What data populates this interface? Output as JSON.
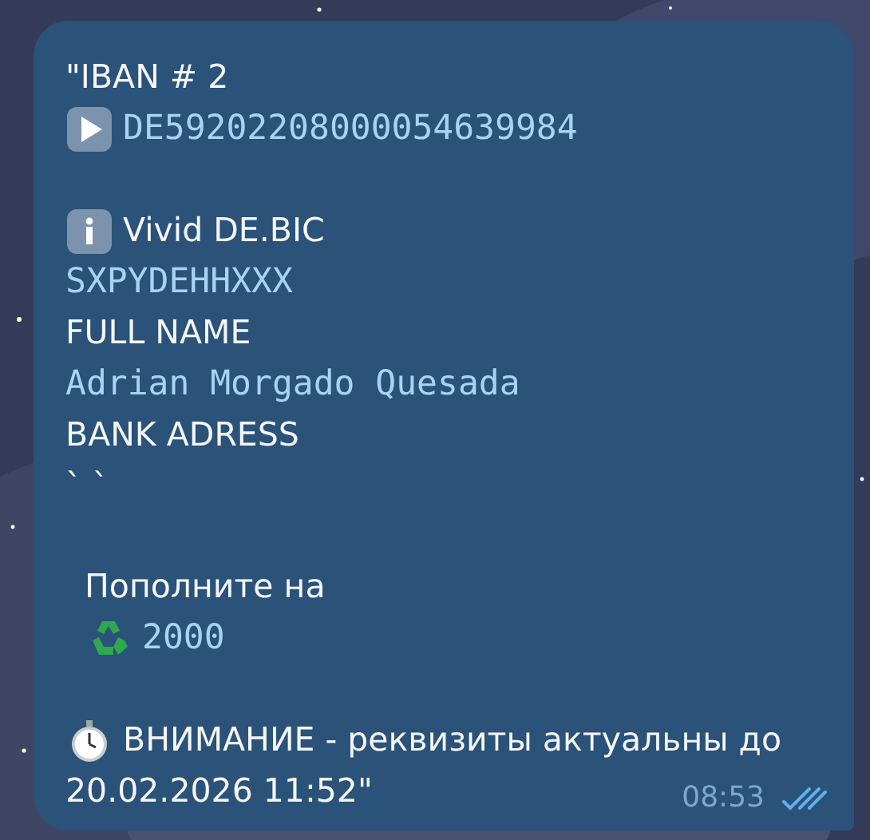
{
  "message": {
    "lines": [
      {
        "kind": "text",
        "text": "\"IBAN # 2"
      },
      {
        "kind": "code",
        "text": "DE59202208000054639984"
      },
      {
        "kind": "gap"
      },
      {
        "kind": "text",
        "text": "Vivid DE.BIC"
      },
      {
        "kind": "code",
        "text": "SXPYDEHHXXX"
      },
      {
        "kind": "text",
        "text": "FULL NAME"
      },
      {
        "kind": "code",
        "text": "Adrian Morgado Quesada"
      },
      {
        "kind": "text",
        "text": "BANK ADRESS"
      },
      {
        "kind": "text",
        "text": "` `"
      },
      {
        "kind": "gap"
      },
      {
        "kind": "text",
        "text": "Пополните на"
      },
      {
        "kind": "code",
        "text": "2000"
      },
      {
        "kind": "gap"
      },
      {
        "kind": "text",
        "text": "ВНИМАНИЕ - реквизиты актуальны до"
      },
      {
        "kind": "text",
        "text": "20.02.2026 11:52\""
      }
    ],
    "time": "08:53",
    "read": true
  }
}
